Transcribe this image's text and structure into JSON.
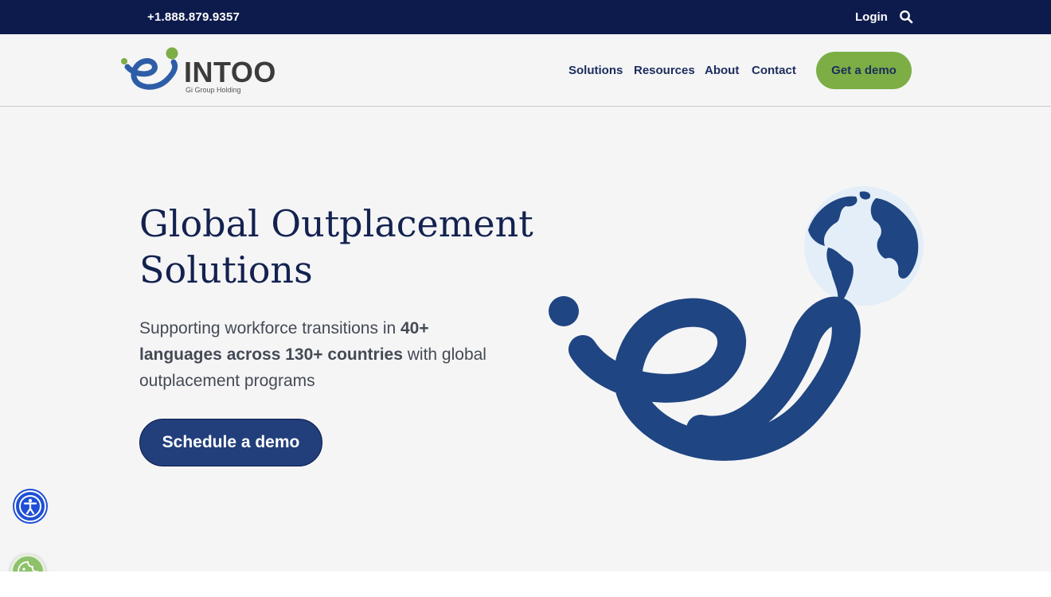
{
  "topbar": {
    "phone": "+1.888.879.9357",
    "login": "Login",
    "search_icon": "search-icon"
  },
  "header": {
    "logo_text": "INTOO",
    "logo_sub": "Gi Group Holding",
    "nav": [
      "Solutions",
      "Resources",
      "About",
      "Contact"
    ],
    "cta": "Get a demo"
  },
  "hero": {
    "title_line1": "Global Outplacement",
    "title_line2": "Solutions",
    "subtitle_pre": "Supporting workforce transitions in ",
    "subtitle_bold": "40+ languages across 130+ countries",
    "subtitle_post": " with global outplacement programs",
    "button": "Schedule a demo"
  },
  "floating": {
    "accessibility_icon": "accessibility-icon",
    "cookie_icon": "cookie-icon"
  },
  "colors": {
    "topbar": "#0d1b4c",
    "brand_blue": "#1f4582",
    "brand_green": "#7cae45",
    "hero_bg": "#f5f5f6"
  }
}
